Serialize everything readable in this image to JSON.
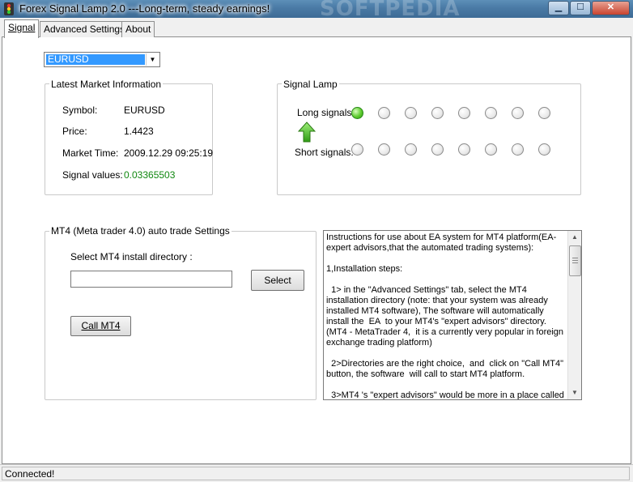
{
  "window": {
    "title": "Forex Signal Lamp 2.0  ---Long-term, steady earnings!",
    "watermark": "SOFTPEDIA",
    "minimize_glyph": "▁",
    "maximize_glyph": "☐",
    "close_glyph": "✕"
  },
  "tabs": [
    {
      "label": "Signal",
      "active": true
    },
    {
      "label": "Advanced Settings",
      "active": false
    },
    {
      "label": "About",
      "active": false
    }
  ],
  "symbol_select": {
    "value": "EURUSD",
    "arrow_glyph": "▼"
  },
  "market_info": {
    "title": "Latest Market Information",
    "rows": [
      {
        "label": "Symbol:",
        "value": "EURUSD"
      },
      {
        "label": "Price:",
        "value": "1.4423"
      },
      {
        "label": "Market Time:",
        "value": "2009.12.29 09:25:19"
      },
      {
        "label": "Signal values:",
        "value": "0.03365503"
      }
    ]
  },
  "signal_lamp": {
    "title": "Signal Lamp",
    "long_label": "Long signals:",
    "short_label": "Short signals:",
    "long_leds": [
      true,
      false,
      false,
      false,
      false,
      false,
      false,
      false
    ],
    "short_leds": [
      false,
      false,
      false,
      false,
      false,
      false,
      false,
      false
    ],
    "arrow_icon": "green-up-arrow-icon"
  },
  "mt4_settings": {
    "title": "MT4 (Meta trader 4.0) auto trade Settings",
    "dir_label": "Select MT4 install directory :",
    "dir_value": "",
    "select_button": "Select",
    "call_button": "Call MT4"
  },
  "instructions": {
    "text": "Instructions for use about EA system for MT4 platform(EA-expert advisors,that the automated trading systems):\n\n1,Installation steps:\n\n  1> in the \"Advanced Settings\" tab, select the MT4 installation directory (note: that your system was already installed MT4 software), The software will automatically install the  EA  to your MT4's \"expert advisors\" directory. (MT4 - MetaTrader 4,  it is a currently very popular in foreign exchange trading platform)\n\n  2>Directories are the right choice,  and  click on \"Call MT4\" button, the software  will call to start MT4 platform.\n\n  3>MT4 's \"expert advisors\" would be more in a place called"
  },
  "status": {
    "text": "Connected!"
  },
  "colors": {
    "led_on": "#5ecb2f",
    "signal_value": "#118811",
    "selection": "#3399ff"
  }
}
